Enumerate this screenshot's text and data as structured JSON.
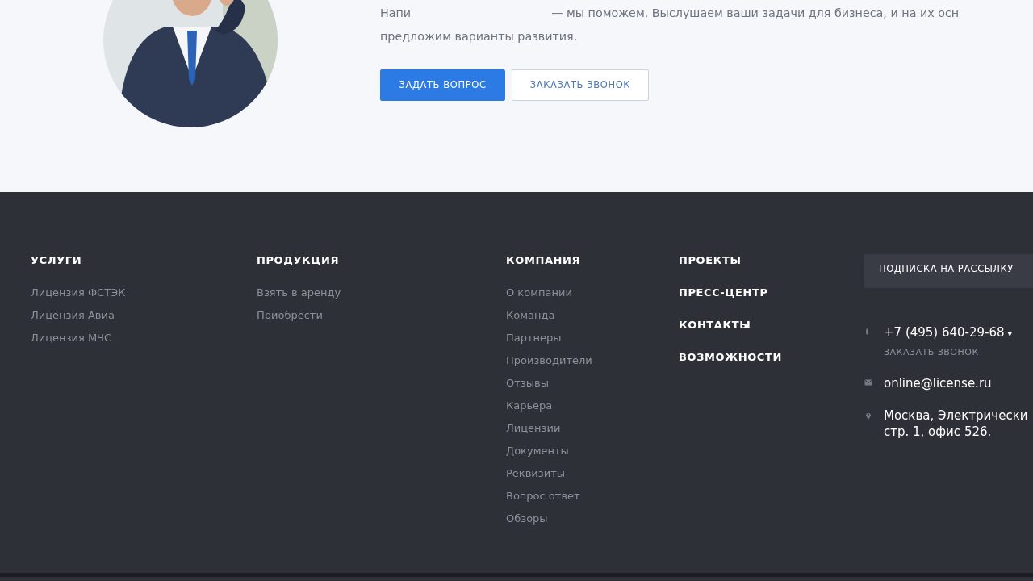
{
  "intro": {
    "text_parts": [
      "Напи",
      "— мы поможем. Выслушаем ваши задачи для бизнеса, и на их осн"
    ],
    "text_line_2": "предложим варианты развития.",
    "buttons": [
      {
        "label": "ЗАДАТЬ ВОПРОС",
        "kind": "primary"
      },
      {
        "label": "ЗАКАЗАТЬ ЗВОНОК",
        "kind": "outline"
      }
    ]
  },
  "footer": {
    "columns": [
      {
        "title": "УСЛУГИ",
        "items": [
          "Лицензия ФСТЭК",
          "Лицензия Авиа",
          "Лицензия МЧС"
        ]
      },
      {
        "title": "ПРОДУКЦИЯ",
        "items": [
          "Взять в аренду",
          "Приобрести"
        ]
      },
      {
        "title": "КОМПАНИЯ",
        "items": [
          "О компании",
          "Команда",
          "Партнеры",
          "Производители",
          "Отзывы",
          "Карьера",
          "Лицензии",
          "Документы",
          "Реквизиты",
          "Вопрос ответ",
          "Обзоры"
        ]
      }
    ],
    "sections": [
      "ПРОЕКТЫ",
      "ПРЕСС-ЦЕНТР",
      "КОНТАКТЫ",
      "ВОЗМОЖНОСТИ"
    ],
    "subscribe_button": "ПОДПИСКА НА РАССЫЛКУ",
    "phone": "+7 (495) 640-29-68",
    "phone_caret": "▾",
    "callback_link": "ЗАКАЗАТЬ ЗВОНОК",
    "email": "online@license.ru",
    "address": [
      "Москва, Электрически",
      "стр. 1, офис 526."
    ]
  }
}
